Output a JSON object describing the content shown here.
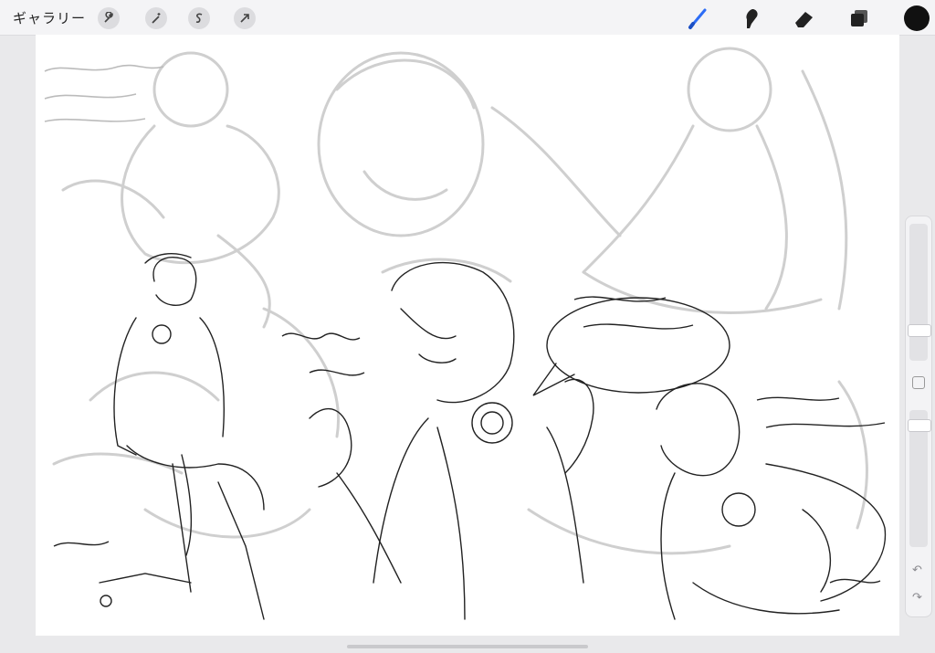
{
  "toolbar": {
    "gallery_label": "ギャラリー",
    "left_icons": [
      "wrench-icon",
      "magic-wand-icon",
      "selection-icon",
      "transform-arrow-icon"
    ],
    "right_tools": [
      "brush-icon",
      "smudge-icon",
      "eraser-icon",
      "layers-icon",
      "color-swatch"
    ],
    "active_tool": "brush-icon",
    "accent_color": "#2d6df6",
    "current_color": "#111111"
  },
  "sidebar": {
    "brush_size_level": 0.28,
    "opacity_level": 0.15,
    "undo_icon": "↶",
    "redo_icon": "↷"
  },
  "canvas": {
    "background": "#ffffff",
    "sketch_color": "#222222",
    "faint_layer_color": "#c8c8c8"
  }
}
